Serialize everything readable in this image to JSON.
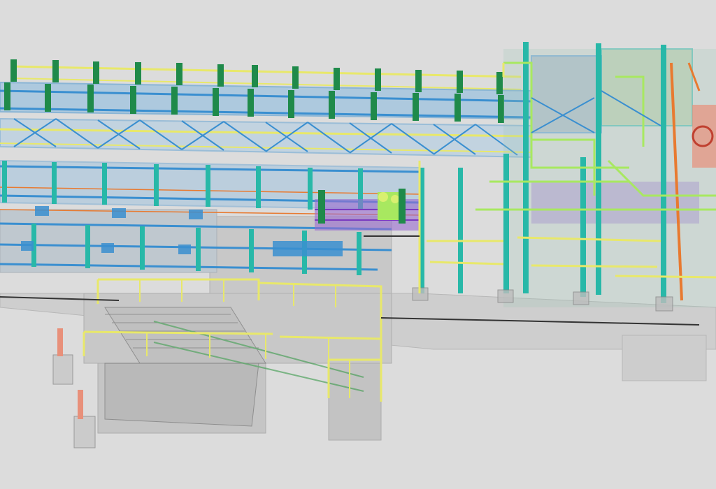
{
  "viewport": {
    "background_color": "#dcdcdc"
  },
  "palette": {
    "steel_blue": "#3a8fd0",
    "rail_yellow": "#e8e86a",
    "column_green": "#1f8a4a",
    "teal_column": "#28b8a8",
    "lime_pipe": "#a8e860",
    "orange_pipe": "#e87a30",
    "purple_duct": "#9a6ad0",
    "concrete_gray": "#bdbdbd",
    "pier_salmon": "#e8907a"
  },
  "model": {
    "name_visible": false
  }
}
